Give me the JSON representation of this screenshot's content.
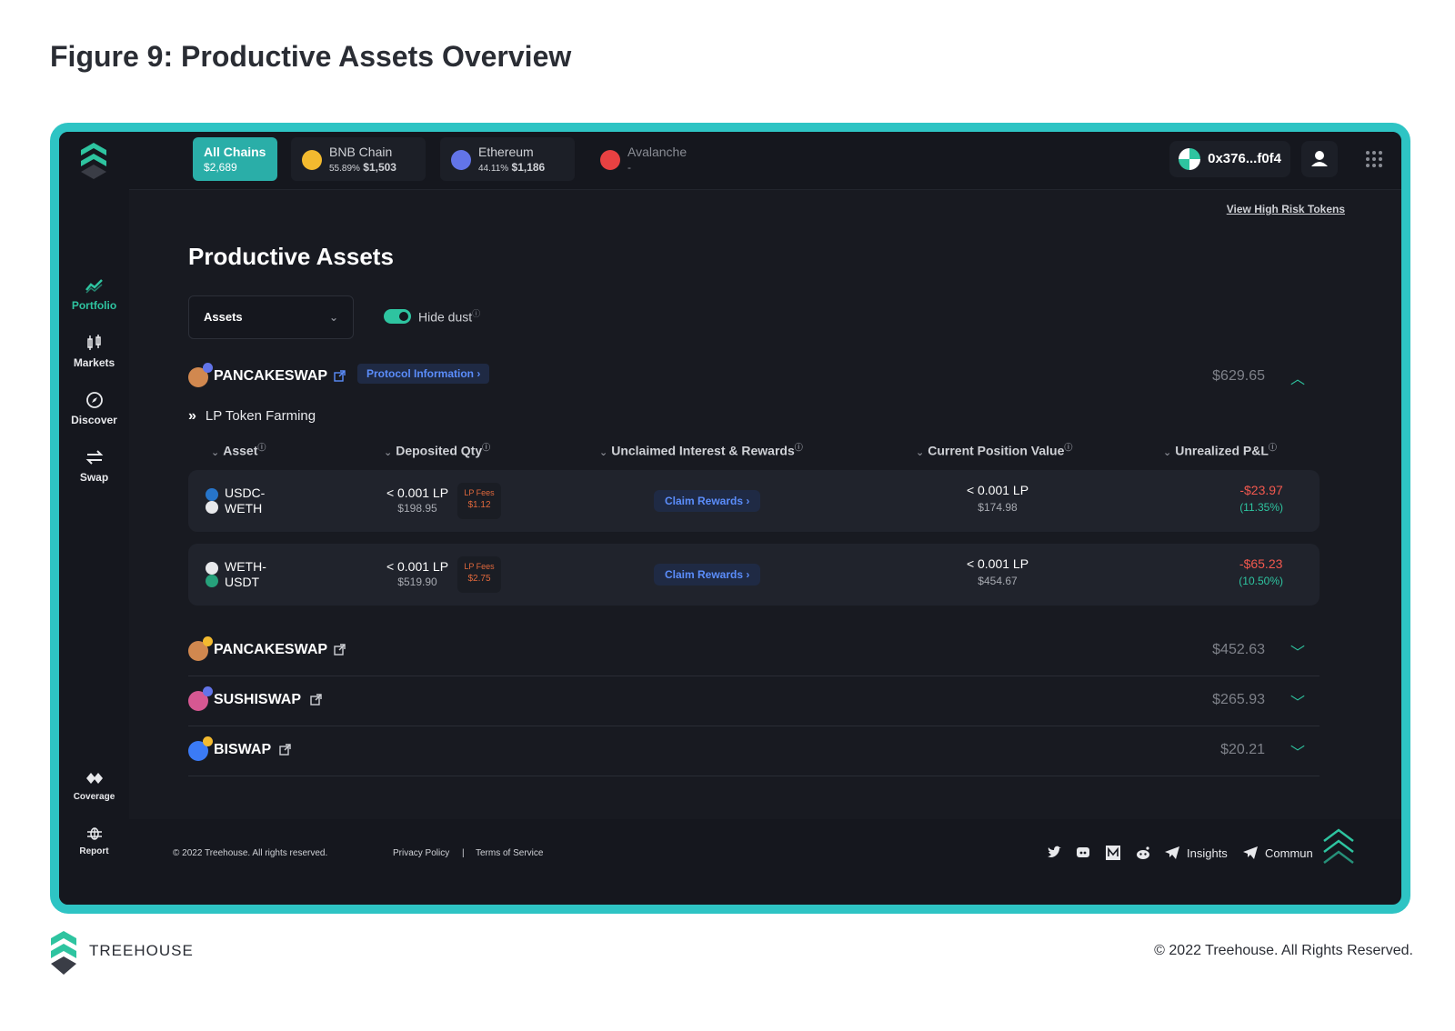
{
  "figure": {
    "title": "Figure 9: Productive Assets Overview"
  },
  "colors": {
    "accent": "#2ec4c4",
    "teal": "#2ec4a0",
    "negative": "#f2584e",
    "link": "#5b8dfb",
    "fees": "#e0683c"
  },
  "sidebar": {
    "items": [
      {
        "label": "Portfolio",
        "icon": "chart-trend-icon"
      },
      {
        "label": "Markets",
        "icon": "candles-icon"
      },
      {
        "label": "Discover",
        "icon": "compass-icon"
      },
      {
        "label": "Swap",
        "icon": "swap-icon"
      },
      {
        "label": "Coverage",
        "icon": "shield-pair-icon"
      },
      {
        "label": "Report",
        "icon": "bug-icon"
      }
    ]
  },
  "topbar": {
    "chains": [
      {
        "name": "All Chains",
        "sub_pct": "",
        "sub_value": "$2,689"
      },
      {
        "name": "BNB Chain",
        "sub_pct": "55.89%",
        "sub_value": "$1,503"
      },
      {
        "name": "Ethereum",
        "sub_pct": "44.11%",
        "sub_value": "$1,186"
      },
      {
        "name": "Avalanche",
        "sub_pct": "",
        "sub_value": "-"
      }
    ],
    "wallet": "0x376...f0f4"
  },
  "main": {
    "view_high_risk": "View High Risk Tokens",
    "title": "Productive Assets",
    "select_value": "Assets",
    "hide_dust": "Hide dust",
    "info_mark": "ⓘ",
    "protocols": [
      {
        "name": "PANCAKESWAP",
        "value": "$629.65",
        "info": "Protocol Information",
        "expanded": true
      },
      {
        "name": "PANCAKESWAP",
        "value": "$452.63",
        "expanded": false
      },
      {
        "name": "SUSHISWAP",
        "value": "$265.93",
        "expanded": false
      },
      {
        "name": "BISWAP",
        "value": "$20.21",
        "expanded": false
      }
    ],
    "section_label": "LP Token Farming",
    "columns": [
      "Asset",
      "Deposited Qty",
      "Unclaimed Interest & Rewards",
      "Current Position Value",
      "Unrealized P&L"
    ],
    "rows": [
      {
        "pair_top": "USDC-",
        "pair_bottom": "WETH",
        "dep_qty": "< 0.001 LP",
        "dep_usd": "$198.95",
        "fees_label": "LP Fees",
        "fees_value": "$1.12",
        "claim": "Claim Rewards",
        "pos_qty": "< 0.001 LP",
        "pos_usd": "$174.98",
        "pnl": "-$23.97",
        "pnl_pct": "(11.35%)"
      },
      {
        "pair_top": "WETH-",
        "pair_bottom": "USDT",
        "dep_qty": "< 0.001 LP",
        "dep_usd": "$519.90",
        "fees_label": "LP Fees",
        "fees_value": "$2.75",
        "claim": "Claim Rewards",
        "pos_qty": "< 0.001 LP",
        "pos_usd": "$454.67",
        "pnl": "-$65.23",
        "pnl_pct": "(10.50%)"
      }
    ]
  },
  "footer": {
    "copyright": "© 2022 Treehouse. All rights reserved.",
    "privacy": "Privacy Policy",
    "separator": "|",
    "terms": "Terms of Service",
    "insights": "Insights",
    "community": "Commun"
  },
  "page_footer": {
    "brand": "TREEHOUSE",
    "copyright": "© 2022 Treehouse. All Rights Reserved."
  }
}
